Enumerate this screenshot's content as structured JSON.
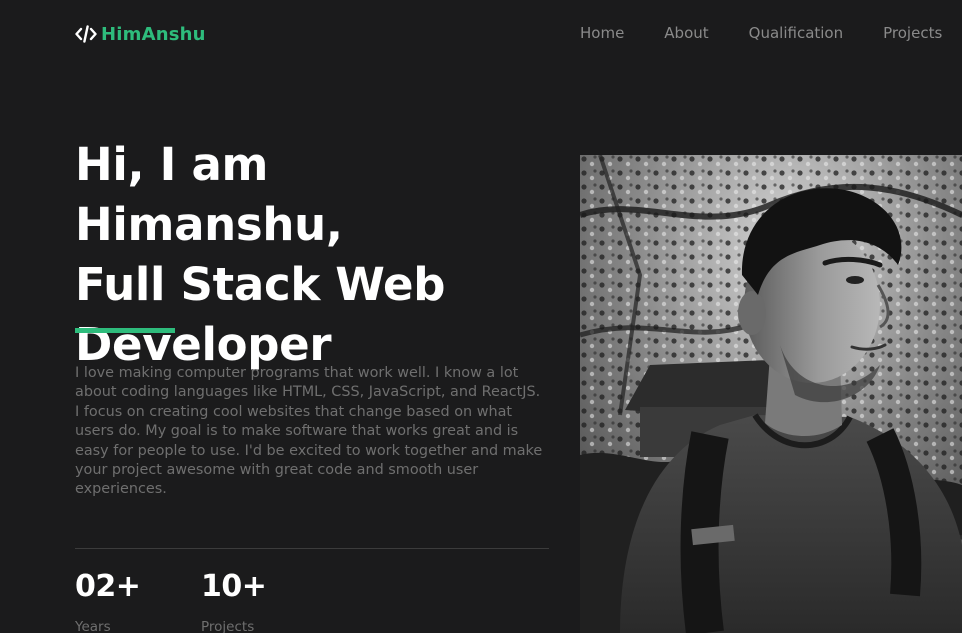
{
  "header": {
    "logo": {
      "icon": "code-brackets-icon",
      "text": "HimAnshu",
      "color": "#2ebc7c"
    },
    "nav": [
      {
        "label": "Home"
      },
      {
        "label": "About"
      },
      {
        "label": "Qualification"
      },
      {
        "label": "Projects"
      }
    ]
  },
  "hero": {
    "title_line1": "Hi, I am Himanshu,",
    "title_line2": "Full Stack Web",
    "title_line3": "Developer",
    "accent_color": "#2ebc7c",
    "intro": "I love making computer programs that work well. I know a lot about coding languages like HTML, CSS, JavaScript, and ReactJS. I focus on creating cool websites that change based on what users do. My goal is to make software that works great and is easy for people to use. I'd be excited to work together and make your project awesome with great code and smooth user experiences.",
    "stats": [
      {
        "value": "02+",
        "label": "Years"
      },
      {
        "value": "10+",
        "label": "Projects"
      }
    ]
  },
  "colors": {
    "background": "#1b1b1c",
    "accent": "#2ebc7c",
    "muted_text": "#6f6f6f"
  }
}
